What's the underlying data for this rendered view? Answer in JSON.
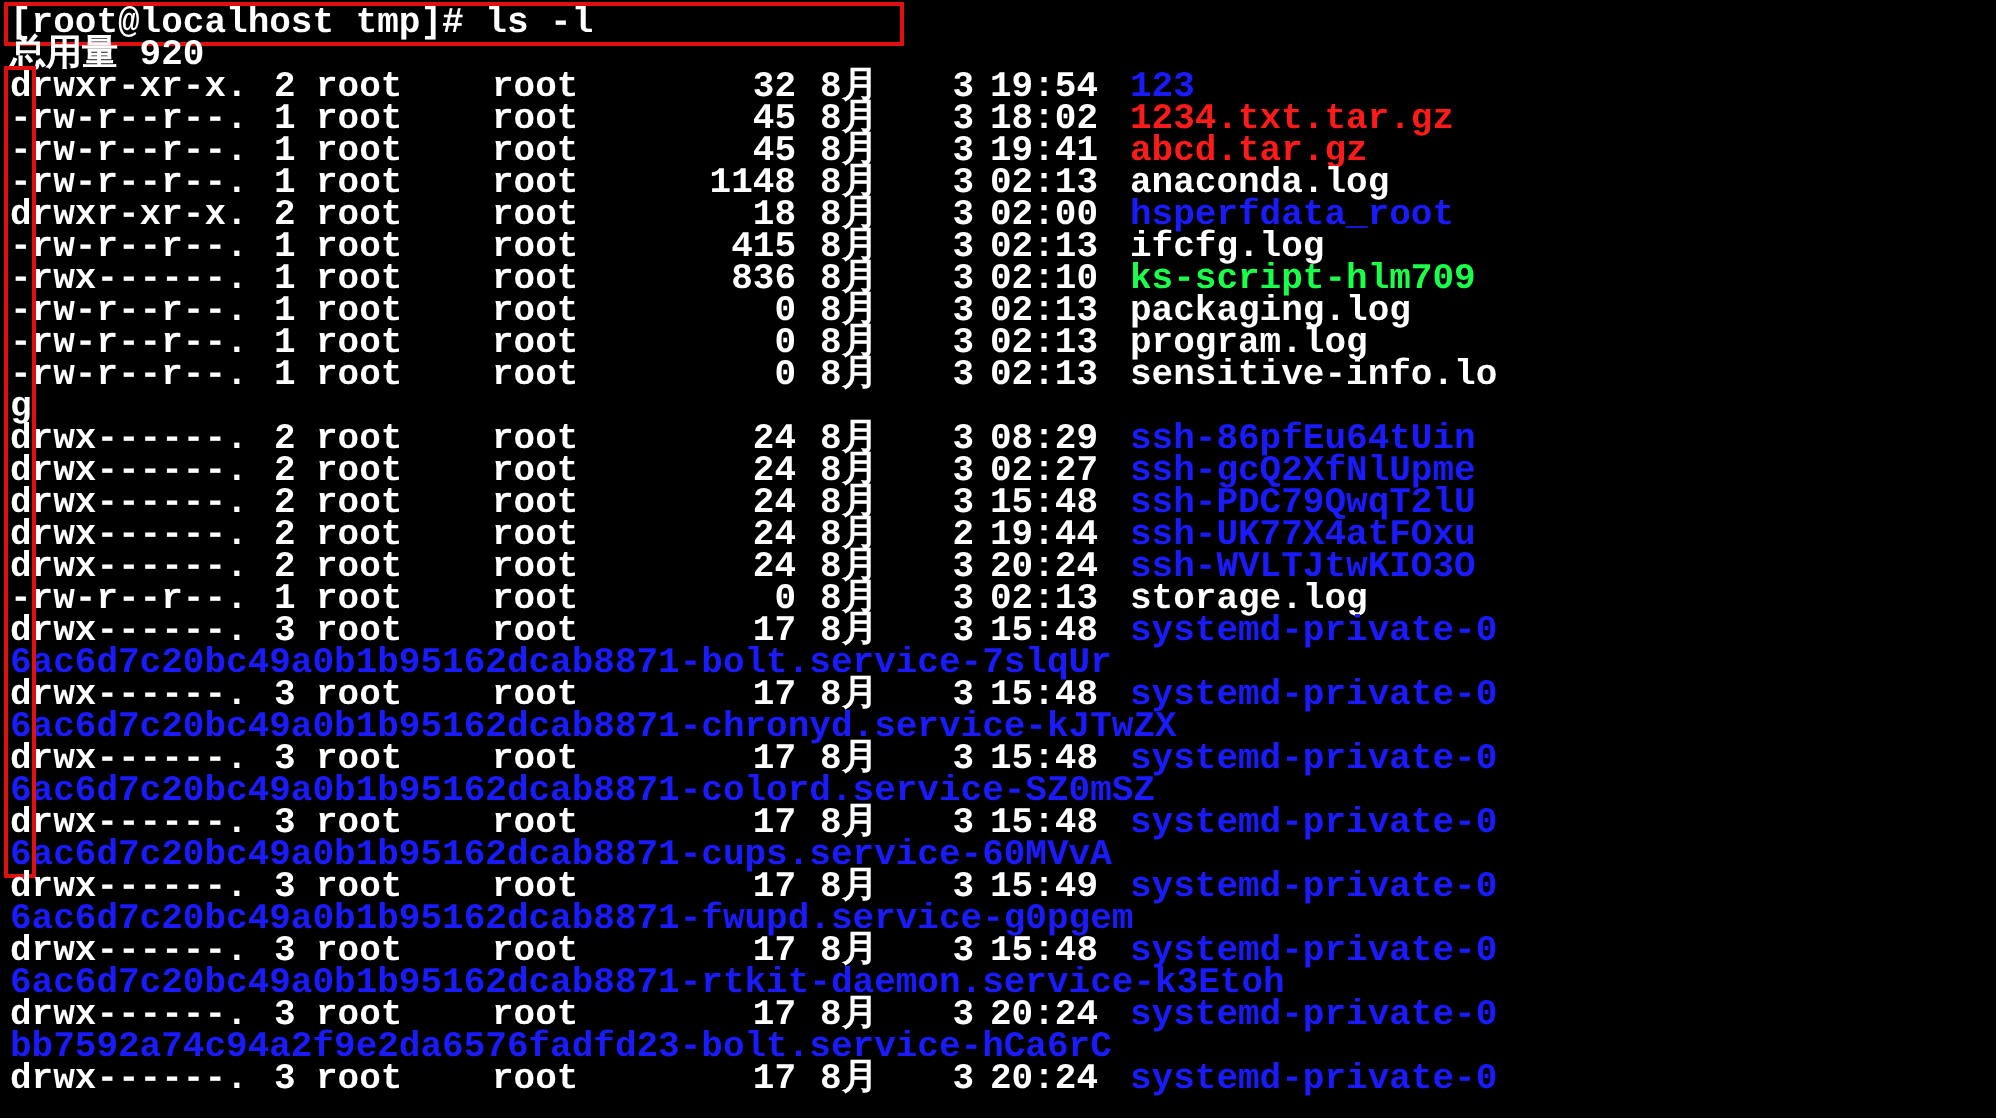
{
  "command": {
    "prompt": "[root@localhost tmp]# ",
    "text": "ls -l",
    "highlighted": true
  },
  "total": "总用量 920",
  "entries": [
    {
      "perms": "drwxr-xr-x.",
      "links": "2",
      "owner": "root",
      "group": "root",
      "size": "32",
      "month": "8月",
      "day": "3",
      "time": "19:54",
      "name": "123",
      "kind": "directory",
      "highlighted": true
    },
    {
      "perms": "-rw-r--r--.",
      "links": "1",
      "owner": "root",
      "group": "root",
      "size": "45",
      "month": "8月",
      "day": "3",
      "time": "18:02",
      "name": "1234.txt.tar.gz",
      "kind": "archive",
      "highlighted": true
    },
    {
      "perms": "-rw-r--r--.",
      "links": "1",
      "owner": "root",
      "group": "root",
      "size": "45",
      "month": "8月",
      "day": "3",
      "time": "19:41",
      "name": "abcd.tar.gz",
      "kind": "archive",
      "highlighted": true
    },
    {
      "perms": "-rw-r--r--.",
      "links": "1",
      "owner": "root",
      "group": "root",
      "size": "1148",
      "month": "8月",
      "day": "3",
      "time": "02:13",
      "name": "anaconda.log",
      "kind": "file",
      "highlighted": true
    },
    {
      "perms": "drwxr-xr-x.",
      "links": "2",
      "owner": "root",
      "group": "root",
      "size": "18",
      "month": "8月",
      "day": "3",
      "time": "02:00",
      "name": "hsperfdata_root",
      "kind": "directory",
      "highlighted": true
    },
    {
      "perms": "-rw-r--r--.",
      "links": "1",
      "owner": "root",
      "group": "root",
      "size": "415",
      "month": "8月",
      "day": "3",
      "time": "02:13",
      "name": "ifcfg.log",
      "kind": "file",
      "highlighted": true
    },
    {
      "perms": "-rwx------.",
      "links": "1",
      "owner": "root",
      "group": "root",
      "size": "836",
      "month": "8月",
      "day": "3",
      "time": "02:10",
      "name": "ks-script-hlm709",
      "kind": "executable",
      "highlighted": true
    },
    {
      "perms": "-rw-r--r--.",
      "links": "1",
      "owner": "root",
      "group": "root",
      "size": "0",
      "month": "8月",
      "day": "3",
      "time": "02:13",
      "name": "packaging.log",
      "kind": "file",
      "highlighted": true
    },
    {
      "perms": "-rw-r--r--.",
      "links": "1",
      "owner": "root",
      "group": "root",
      "size": "0",
      "month": "8月",
      "day": "3",
      "time": "02:13",
      "name": "program.log",
      "kind": "file",
      "highlighted": true
    },
    {
      "perms": "-rw-r--r--.",
      "links": "1",
      "owner": "root",
      "group": "root",
      "size": "0",
      "month": "8月",
      "day": "3",
      "time": "02:13",
      "name": "sensitive-info.lo",
      "name_wrapped": "g",
      "kind": "file",
      "highlighted": true
    },
    {
      "perms": "drwx------.",
      "links": "2",
      "owner": "root",
      "group": "root",
      "size": "24",
      "month": "8月",
      "day": "3",
      "time": "08:29",
      "name": "ssh-86pfEu64tUin",
      "kind": "directory",
      "highlighted": true
    },
    {
      "perms": "drwx------.",
      "links": "2",
      "owner": "root",
      "group": "root",
      "size": "24",
      "month": "8月",
      "day": "3",
      "time": "02:27",
      "name": "ssh-gcQ2XfNlUpme",
      "kind": "directory",
      "highlighted": true
    },
    {
      "perms": "drwx------.",
      "links": "2",
      "owner": "root",
      "group": "root",
      "size": "24",
      "month": "8月",
      "day": "3",
      "time": "15:48",
      "name": "ssh-PDC79QwqT2lU",
      "kind": "directory",
      "highlighted": true
    },
    {
      "perms": "drwx------.",
      "links": "2",
      "owner": "root",
      "group": "root",
      "size": "24",
      "month": "8月",
      "day": "2",
      "time": "19:44",
      "name": "ssh-UK77X4atFOxu",
      "kind": "directory",
      "highlighted": true
    },
    {
      "perms": "drwx------.",
      "links": "2",
      "owner": "root",
      "group": "root",
      "size": "24",
      "month": "8月",
      "day": "3",
      "time": "20:24",
      "name": "ssh-WVLTJtwKIO3O",
      "kind": "directory",
      "highlighted": true
    },
    {
      "perms": "-rw-r--r--.",
      "links": "1",
      "owner": "root",
      "group": "root",
      "size": "0",
      "month": "8月",
      "day": "3",
      "time": "02:13",
      "name": "storage.log",
      "kind": "file",
      "highlighted": true
    },
    {
      "perms": "drwx------.",
      "links": "3",
      "owner": "root",
      "group": "root",
      "size": "17",
      "month": "8月",
      "day": "3",
      "time": "15:48",
      "name": "systemd-private-0",
      "name_wrapped": "6ac6d7c20bc49a0b1b95162dcab8871-bolt.service-7slqUr",
      "kind": "directory",
      "highlighted": true
    },
    {
      "perms": "drwx------.",
      "links": "3",
      "owner": "root",
      "group": "root",
      "size": "17",
      "month": "8月",
      "day": "3",
      "time": "15:48",
      "name": "systemd-private-0",
      "name_wrapped": "6ac6d7c20bc49a0b1b95162dcab8871-chronyd.service-kJTwZX",
      "kind": "directory",
      "highlighted": true
    },
    {
      "perms": "drwx------.",
      "links": "3",
      "owner": "root",
      "group": "root",
      "size": "17",
      "month": "8月",
      "day": "3",
      "time": "15:48",
      "name": "systemd-private-0",
      "name_wrapped": "6ac6d7c20bc49a0b1b95162dcab8871-colord.service-SZ0mSZ",
      "kind": "directory",
      "highlighted": true
    },
    {
      "perms": "drwx------.",
      "links": "3",
      "owner": "root",
      "group": "root",
      "size": "17",
      "month": "8月",
      "day": "3",
      "time": "15:48",
      "name": "systemd-private-0",
      "name_wrapped": "6ac6d7c20bc49a0b1b95162dcab8871-cups.service-60MVvA",
      "kind": "directory",
      "highlighted": true
    },
    {
      "perms": "drwx------.",
      "links": "3",
      "owner": "root",
      "group": "root",
      "size": "17",
      "month": "8月",
      "day": "3",
      "time": "15:49",
      "name": "systemd-private-0",
      "name_wrapped": "6ac6d7c20bc49a0b1b95162dcab8871-fwupd.service-g0pgem",
      "kind": "directory",
      "highlighted": false
    },
    {
      "perms": "drwx------.",
      "links": "3",
      "owner": "root",
      "group": "root",
      "size": "17",
      "month": "8月",
      "day": "3",
      "time": "15:48",
      "name": "systemd-private-0",
      "name_wrapped": "6ac6d7c20bc49a0b1b95162dcab8871-rtkit-daemon.service-k3Etoh",
      "kind": "directory",
      "highlighted": false
    },
    {
      "perms": "drwx------.",
      "links": "3",
      "owner": "root",
      "group": "root",
      "size": "17",
      "month": "8月",
      "day": "3",
      "time": "20:24",
      "name": "systemd-private-0",
      "name_wrapped": "bb7592a74c94a2f9e2da6576fadfd23-bolt.service-hCa6rC",
      "kind": "directory",
      "highlighted": false
    },
    {
      "perms": "drwx------.",
      "links": "3",
      "owner": "root",
      "group": "root",
      "size": "17",
      "month": "8月",
      "day": "3",
      "time": "20:24",
      "name": "systemd-private-0",
      "kind": "directory",
      "highlighted": false
    }
  ]
}
